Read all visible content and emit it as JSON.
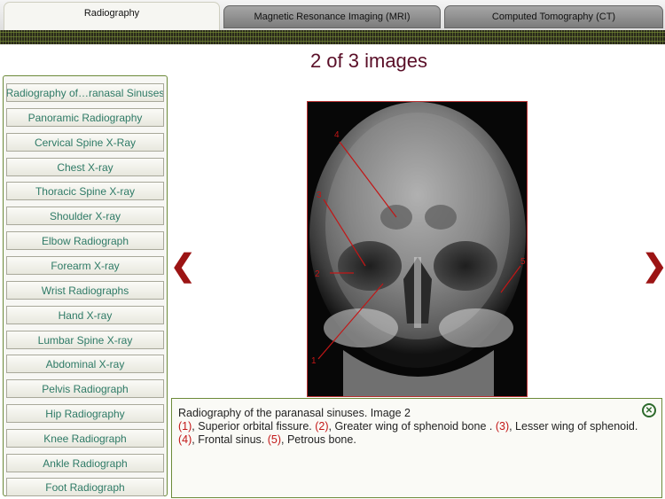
{
  "tabs": [
    {
      "label": "Radiography",
      "active": true
    },
    {
      "label": "Magnetic Resonance Imaging (MRI)",
      "active": false
    },
    {
      "label": "Computed Tomography (CT)",
      "active": false
    }
  ],
  "sidebar": {
    "items": [
      {
        "label": "Radiography of…ranasal Sinuses"
      },
      {
        "label": "Panoramic Radiography"
      },
      {
        "label": "Cervical Spine X-Ray"
      },
      {
        "label": "Chest X-ray"
      },
      {
        "label": "Thoracic Spine X-ray"
      },
      {
        "label": "Shoulder X-ray"
      },
      {
        "label": "Elbow Radiograph"
      },
      {
        "label": "Forearm X-ray"
      },
      {
        "label": "Wrist Radiographs"
      },
      {
        "label": "Hand X-ray"
      },
      {
        "label": "Lumbar Spine X-ray"
      },
      {
        "label": "Abdominal X-ray"
      },
      {
        "label": "Pelvis Radiograph"
      },
      {
        "label": "Hip Radiography"
      },
      {
        "label": "Knee Radiograph"
      },
      {
        "label": "Ankle Radiograph"
      },
      {
        "label": "Foot Radiograph"
      }
    ]
  },
  "viewer": {
    "counter": "2 of 3 images",
    "prev_icon": "chevron-left-icon",
    "next_icon": "chevron-right-icon",
    "marker_labels": [
      "1",
      "2",
      "3",
      "4",
      "5"
    ]
  },
  "caption": {
    "title": "Radiography of the paranasal sinuses. Image 2",
    "parts": [
      {
        "num": "(1)",
        "text": ", Superior orbital fissure. "
      },
      {
        "num": "(2)",
        "text": ", Greater wing of sphenoid bone . "
      },
      {
        "num": "(3)",
        "text": ", Lesser wing of sphenoid. "
      },
      {
        "num": "(4)",
        "text": ", Frontal sinus. "
      },
      {
        "num": "(5)",
        "text": ", Petrous bone."
      }
    ],
    "close_icon": "close-circle-icon"
  },
  "colors": {
    "accent_green": "#6c8a3a",
    "list_text": "#2e7a66",
    "counter_text": "#5a0f28",
    "arrow": "#9c1414",
    "marker_red": "#c21616"
  }
}
